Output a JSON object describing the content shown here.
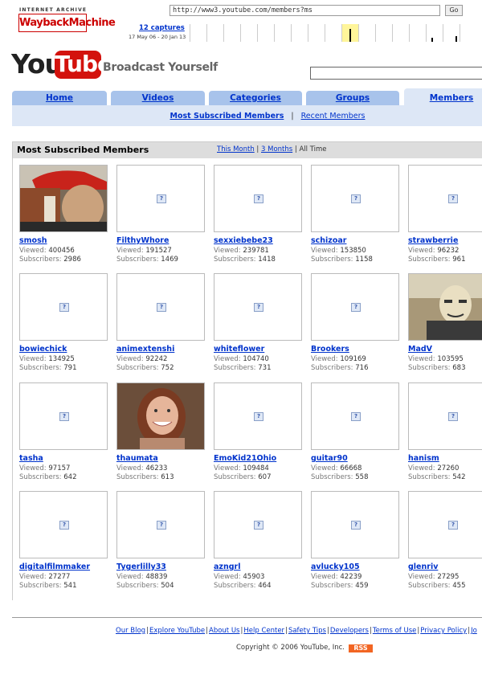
{
  "wayback": {
    "logo_top": "INTERNET ARCHIVE",
    "logo_main": "WaybackMachine",
    "url": "http://www3.youtube.com/members?ms",
    "go": "Go",
    "captures": "12 captures",
    "range": "17 May 06 - 20 Jan 13"
  },
  "header": {
    "logo_you": "You",
    "logo_tube": "Tube",
    "tagline": "Broadcast Yourself",
    "search_value": ""
  },
  "tabs": [
    "Home",
    "Videos",
    "Categories",
    "Groups",
    "Members"
  ],
  "subnav": {
    "most_subscribed": "Most Subscribed Members",
    "separator": "|",
    "recent": "Recent Members"
  },
  "members": {
    "title": "Most Subscribed Members",
    "filter": {
      "this_month": "This Month",
      "three_months": "3 Months",
      "all_time": "All Time",
      "sep": "|"
    },
    "viewed_label": "Viewed:",
    "subscribers_label": "Subscribers:",
    "placeholder_glyph": "?",
    "list": [
      {
        "name": "smosh",
        "viewed": "400456",
        "subscribers": "2986",
        "photo": "person-red-cap"
      },
      {
        "name": "FilthyWhore",
        "viewed": "191527",
        "subscribers": "1469"
      },
      {
        "name": "sexxiebebe23",
        "viewed": "239781",
        "subscribers": "1418"
      },
      {
        "name": "schizoar",
        "viewed": "153850",
        "subscribers": "1158"
      },
      {
        "name": "strawberrie",
        "viewed": "96232",
        "subscribers": "961"
      },
      {
        "name": "bowiechick",
        "viewed": "134925",
        "subscribers": "791"
      },
      {
        "name": "animextenshi",
        "viewed": "92242",
        "subscribers": "752"
      },
      {
        "name": "whiteflower",
        "viewed": "104740",
        "subscribers": "731"
      },
      {
        "name": "Brookers",
        "viewed": "109169",
        "subscribers": "716"
      },
      {
        "name": "MadV",
        "viewed": "103595",
        "subscribers": "683",
        "photo": "masked-person"
      },
      {
        "name": "tasha",
        "viewed": "97157",
        "subscribers": "642"
      },
      {
        "name": "thaumata",
        "viewed": "46233",
        "subscribers": "613",
        "photo": "smiling-woman"
      },
      {
        "name": "EmoKid21Ohio",
        "viewed": "109484",
        "subscribers": "607"
      },
      {
        "name": "guitar90",
        "viewed": "66668",
        "subscribers": "558"
      },
      {
        "name": "hanism",
        "viewed": "27260",
        "subscribers": "542"
      },
      {
        "name": "digitalfilmmaker",
        "viewed": "27277",
        "subscribers": "541"
      },
      {
        "name": "Tygerlilly33",
        "viewed": "48839",
        "subscribers": "504"
      },
      {
        "name": "azngrl",
        "viewed": "45903",
        "subscribers": "464"
      },
      {
        "name": "avlucky105",
        "viewed": "42239",
        "subscribers": "459"
      },
      {
        "name": "glenriv",
        "viewed": "27295",
        "subscribers": "455"
      }
    ]
  },
  "footer": {
    "links": [
      "Our Blog",
      "Explore YouTube",
      "About Us",
      "Help Center",
      "Safety Tips",
      "Developers",
      "Terms of Use",
      "Privacy Policy",
      "Jo"
    ],
    "separator": "|",
    "copyright": "Copyright © 2006 YouTube, Inc.",
    "rss": "RSS"
  }
}
